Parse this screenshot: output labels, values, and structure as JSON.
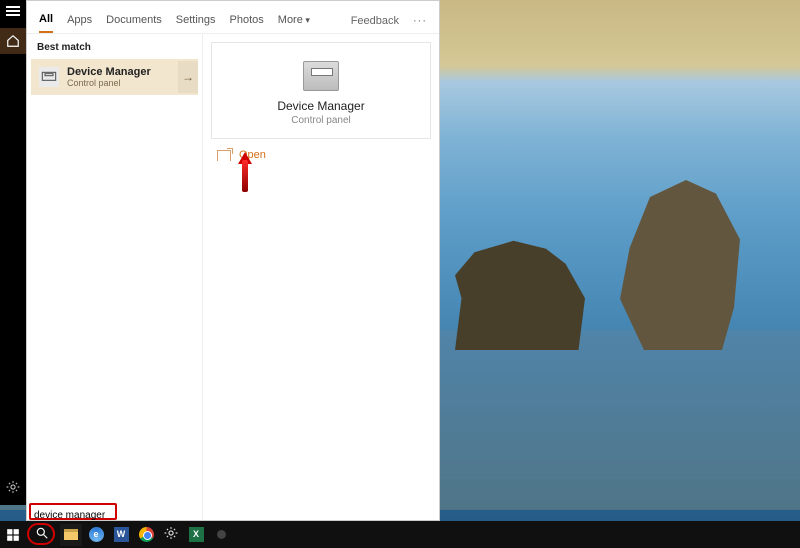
{
  "tabs": {
    "all": "All",
    "apps": "Apps",
    "documents": "Documents",
    "settings": "Settings",
    "photos": "Photos",
    "more": "More",
    "feedback": "Feedback"
  },
  "left": {
    "section": "Best match",
    "result": {
      "title": "Device Manager",
      "subtitle": "Control panel"
    }
  },
  "preview": {
    "title": "Device Manager",
    "subtitle": "Control panel"
  },
  "actions": {
    "open": "Open"
  },
  "search": {
    "value": "device manager"
  },
  "rail": {
    "menu_icon": "hamburger-icon",
    "home_icon": "home-icon",
    "settings_icon": "gear-icon"
  },
  "taskbar": {
    "start": "start-icon",
    "search": "search-icon",
    "explorer": "file-explorer",
    "edge": "E",
    "word": "W",
    "chrome": "chrome",
    "settings": "gear-icon",
    "excel": "X",
    "obs": "obs"
  }
}
